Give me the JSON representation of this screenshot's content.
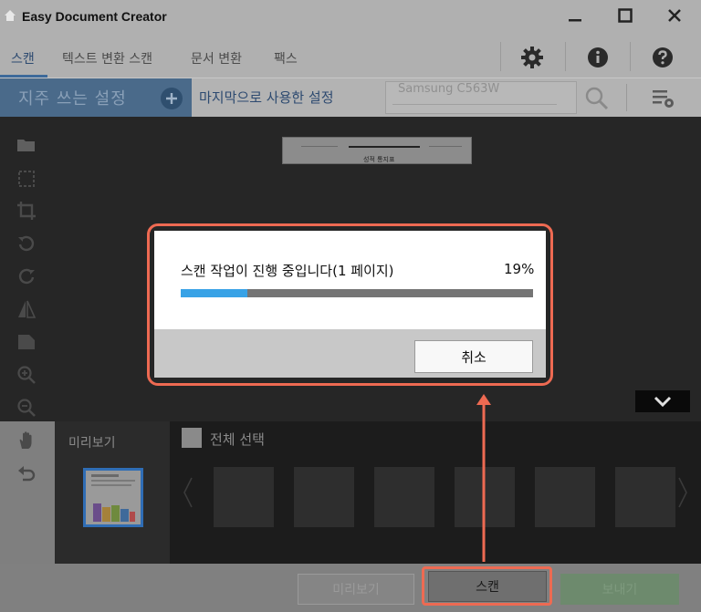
{
  "titlebar": {
    "title": "Easy Document Creator",
    "icons": {
      "home": "home-icon",
      "minimize": "minimize-icon",
      "maximize": "maximize-icon",
      "close": "close-icon"
    }
  },
  "tabs": [
    {
      "label": "스캔",
      "active": true
    },
    {
      "label": "텍스트 변환 스캔",
      "active": false
    },
    {
      "label": "문서 변환",
      "active": false
    },
    {
      "label": "팩스",
      "active": false
    }
  ],
  "toolbar": {
    "icons": [
      "gear-icon",
      "info-icon",
      "help-icon"
    ]
  },
  "settings_bar": {
    "favorites_label": "지주 쓰는 설정",
    "last_used_label": "마지막으로 사용한 설정",
    "device": "Samsung C563W"
  },
  "left_tools": [
    "open-folder-icon",
    "select-icon",
    "crop-icon",
    "rotate-left-icon",
    "rotate-right-icon",
    "flip-icon",
    "document-icon",
    "zoom-in-icon",
    "zoom-out-icon",
    "pan-hand-icon",
    "undo-icon"
  ],
  "canvas": {
    "doc_title": "성적 통지표"
  },
  "preview": {
    "label": "미리보기"
  },
  "thumbnails": {
    "select_all_label": "전체 선택"
  },
  "dialog": {
    "message": "스캔 작업이 진행 중입니다(1 페이지)",
    "percent_text": "19%",
    "progress": 0.19,
    "cancel_label": "취소"
  },
  "bottom": {
    "preview_label": "미리보기",
    "scan_label": "스캔",
    "send_label": "보내기"
  },
  "colors": {
    "progress_fill": "#38a2e6",
    "annotation": "#ee6a52",
    "tab_active": "#2d4a70"
  }
}
